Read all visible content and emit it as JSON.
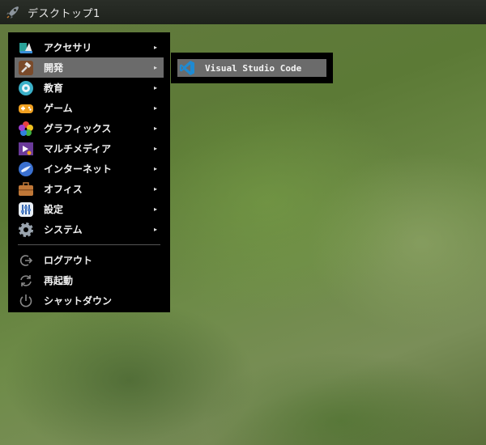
{
  "taskbar": {
    "title": "デスクトップ1",
    "launcher_icon": "rocket-icon"
  },
  "menu": {
    "items": [
      {
        "label": "アクセサリ",
        "icon": "accessories-icon",
        "has_submenu": true
      },
      {
        "label": "開発",
        "icon": "development-icon",
        "has_submenu": true,
        "active": true
      },
      {
        "label": "教育",
        "icon": "education-icon",
        "has_submenu": true
      },
      {
        "label": "ゲーム",
        "icon": "games-icon",
        "has_submenu": true
      },
      {
        "label": "グラフィックス",
        "icon": "graphics-icon",
        "has_submenu": true
      },
      {
        "label": "マルチメディア",
        "icon": "multimedia-icon",
        "has_submenu": true
      },
      {
        "label": "インターネット",
        "icon": "internet-icon",
        "has_submenu": true
      },
      {
        "label": "オフィス",
        "icon": "office-icon",
        "has_submenu": true
      },
      {
        "label": "設定",
        "icon": "settings-icon",
        "has_submenu": true
      },
      {
        "label": "システム",
        "icon": "system-icon",
        "has_submenu": true
      }
    ],
    "actions": [
      {
        "label": "ログアウト",
        "icon": "logout-icon"
      },
      {
        "label": "再起動",
        "icon": "restart-icon"
      },
      {
        "label": "シャットダウン",
        "icon": "power-icon"
      }
    ],
    "submenu_arrow": "▸"
  },
  "submenu": {
    "items": [
      {
        "label": "Visual Studio Code",
        "icon": "vscode-icon"
      }
    ]
  }
}
